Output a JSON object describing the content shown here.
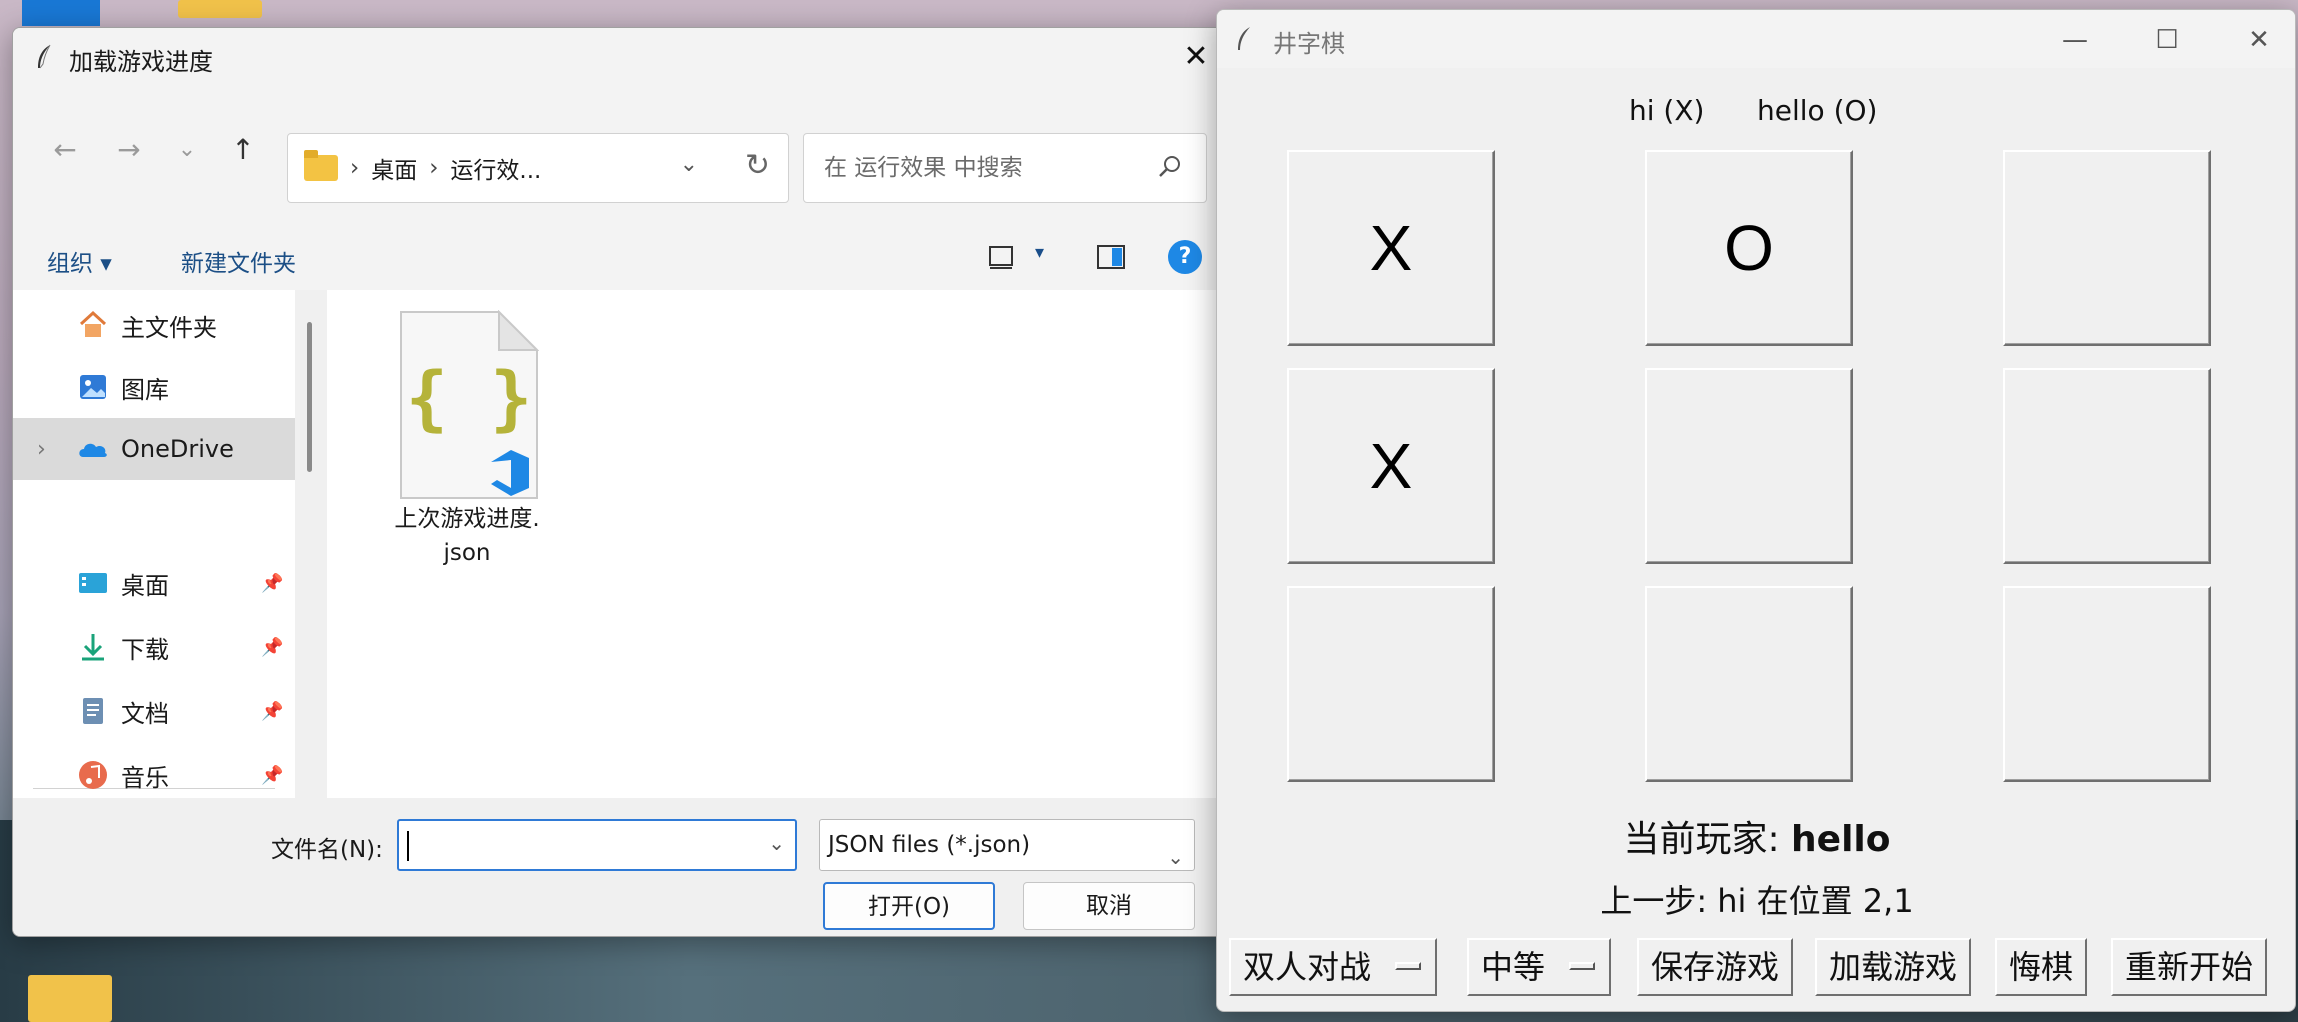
{
  "dialog": {
    "title": "加载游戏进度",
    "close_glyph": "✕",
    "nav": {
      "back": "←",
      "forward": "→",
      "recent": "⌄",
      "up": "↑"
    },
    "path": [
      "桌面",
      "运行效..."
    ],
    "path_sep": "›",
    "search_placeholder": "在 运行效果 中搜索",
    "commands": {
      "organize": "组织 ▾",
      "new_folder": "新建文件夹",
      "help": "?"
    },
    "sidebar": [
      {
        "label": "主文件夹",
        "icon": "home-icon",
        "pinned": false
      },
      {
        "label": "图库",
        "icon": "gallery-icon",
        "pinned": false
      },
      {
        "label": "OneDrive",
        "icon": "onedrive-icon",
        "pinned": false,
        "selected": true,
        "expandable": true
      },
      {
        "label": "桌面",
        "icon": "desktop-icon",
        "pinned": true
      },
      {
        "label": "下载",
        "icon": "download-icon",
        "pinned": true
      },
      {
        "label": "文档",
        "icon": "document-icon",
        "pinned": true
      },
      {
        "label": "音乐",
        "icon": "music-icon",
        "pinned": true
      }
    ],
    "files": [
      {
        "name_line1": "上次游戏进度.",
        "name_line2": "json",
        "icon": "json-file-icon"
      }
    ],
    "filename_label": "文件名(N):",
    "filename_value": "",
    "filter": "JSON files (*.json)",
    "open_label": "打开(O)",
    "cancel_label": "取消"
  },
  "game": {
    "title": "井字棋",
    "player_x": "hi (X)",
    "player_o": "hello (O)",
    "board": [
      "X",
      "O",
      "",
      "X",
      "",
      "",
      "",
      "",
      ""
    ],
    "current_label": "当前玩家: ",
    "current_name": "hello",
    "last_move": "上一步: hi 在位置 2,1",
    "mode": "双人对战",
    "difficulty": "中等",
    "buttons": {
      "save": "保存游戏",
      "load": "加载游戏",
      "undo": "悔棋",
      "restart": "重新开始"
    },
    "window_controls": {
      "minimize": "—",
      "maximize": "☐",
      "close": "✕"
    }
  }
}
